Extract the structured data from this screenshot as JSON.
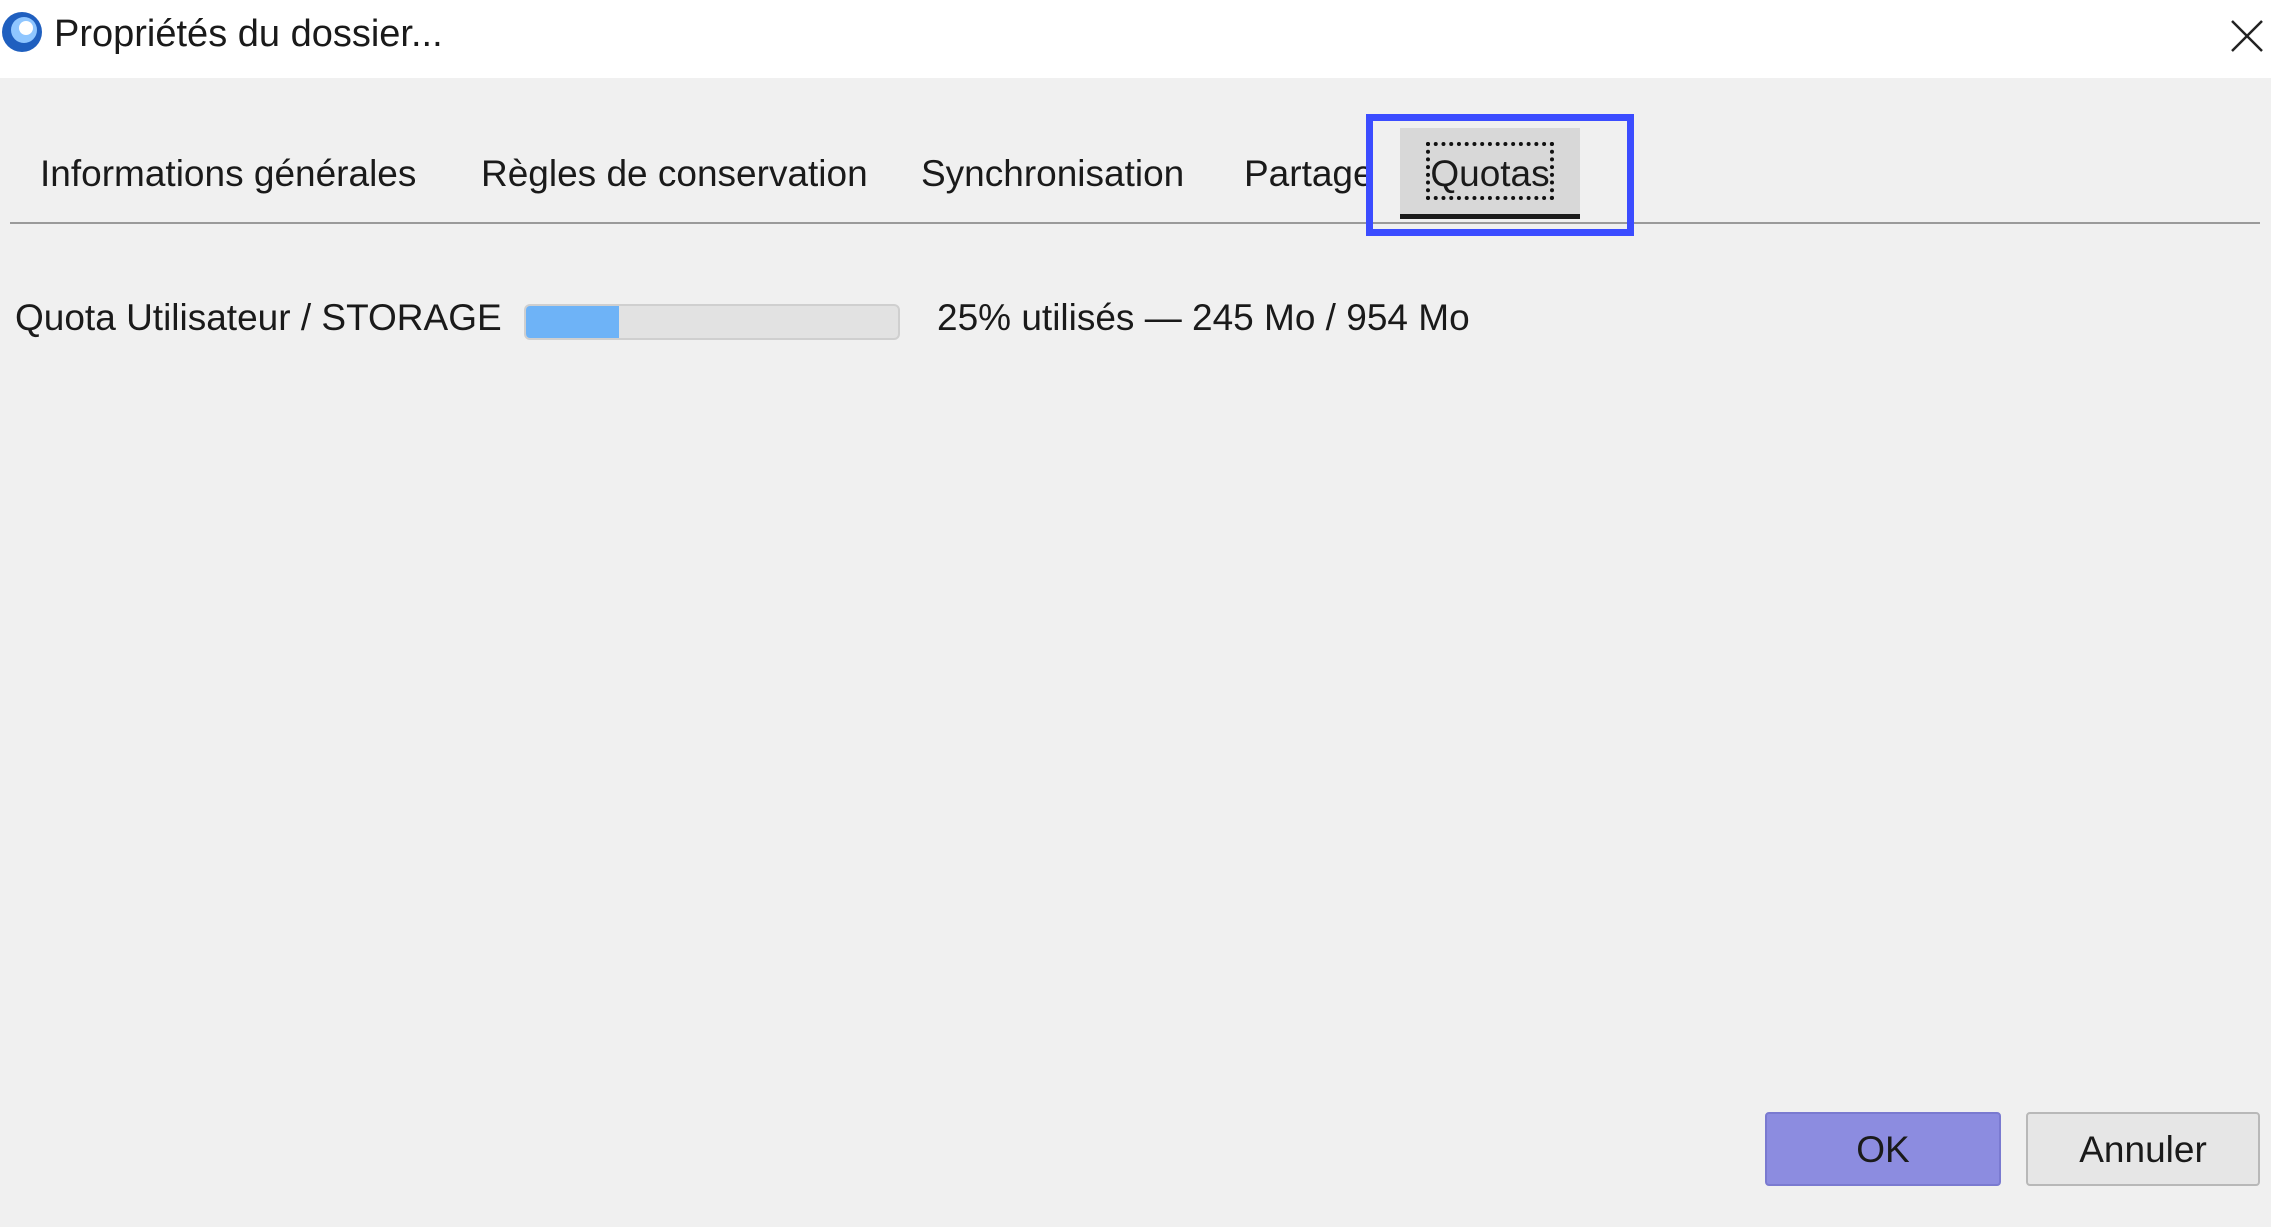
{
  "window": {
    "title": "Propriétés du dossier...",
    "close_icon": "close-icon"
  },
  "tabs": [
    {
      "label": "Informations générales"
    },
    {
      "label": "Règles de conservation"
    },
    {
      "label": "Synchronisation"
    },
    {
      "label": "Partage"
    },
    {
      "label": "Quotas",
      "selected": true
    }
  ],
  "quota": {
    "label": "Quota Utilisateur / STORAGE",
    "percent_used": 25,
    "usage_text": "25% utilisés — 245 Mo / 954 Mo"
  },
  "buttons": {
    "ok_label": "OK",
    "cancel_label": "Annuler"
  },
  "colors": {
    "highlight": "#3b4cff",
    "progress_fill": "#6eb3f7",
    "ok_button": "#8c8ce0"
  }
}
